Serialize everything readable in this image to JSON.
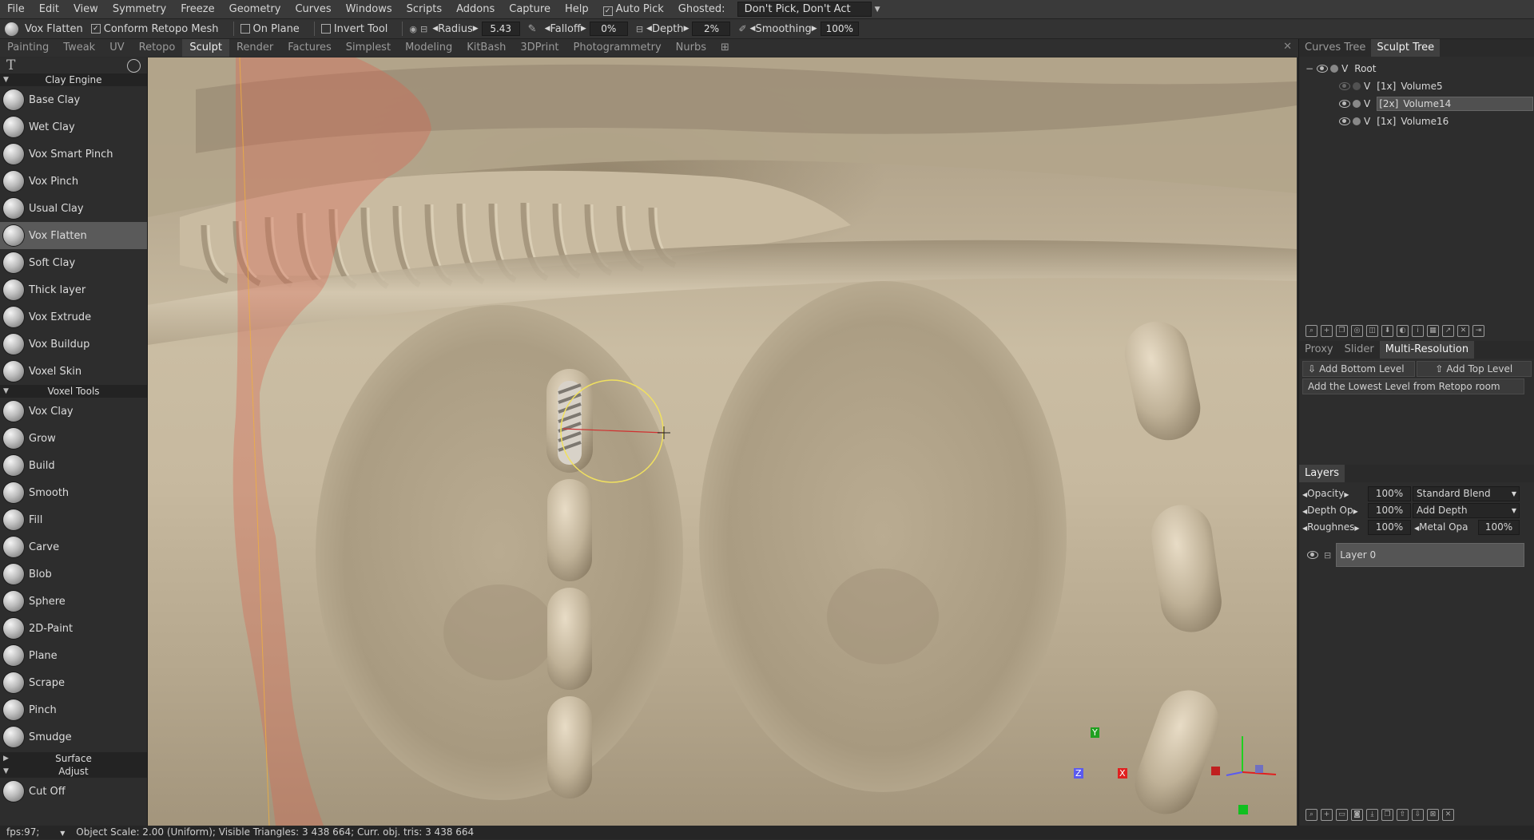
{
  "menubar": {
    "items": [
      "File",
      "Edit",
      "View",
      "Symmetry",
      "Freeze",
      "Geometry",
      "Curves",
      "Windows",
      "Scripts",
      "Addons",
      "Capture",
      "Help"
    ],
    "auto_pick": "Auto Pick",
    "ghosted_label": "Ghosted:",
    "ghosted_value": "Don't Pick, Don't Act"
  },
  "optbar": {
    "tool_name": "Vox Flatten",
    "conform_retopo": "Conform Retopo Mesh",
    "on_plane": "On Plane",
    "invert_tool": "Invert Tool",
    "radius_label": "Radius",
    "radius_value": "5.43",
    "falloff_label": "Falloff",
    "falloff_value": "0%",
    "depth_label": "Depth",
    "depth_value": "2%",
    "smoothing_label": "Smoothing",
    "smoothing_value": "100%"
  },
  "rooms": {
    "tabs": [
      "Painting",
      "Tweak",
      "UV",
      "Retopo",
      "Sculpt",
      "Render",
      "Factures",
      "Simplest",
      "Modeling",
      "KitBash",
      "3DPrint",
      "Photogrammetry",
      "Nurbs"
    ],
    "active": "Sculpt"
  },
  "leftpanel": {
    "clay_engine_title": "Clay Engine",
    "clay_tools": [
      "Base Clay",
      "Wet Clay",
      "Vox Smart Pinch",
      "Vox Pinch",
      "Usual Clay",
      "Vox Flatten",
      "Soft Clay",
      "Thick layer",
      "Vox Extrude",
      "Vox Buildup",
      "Voxel Skin"
    ],
    "voxel_tools_title": "Voxel Tools",
    "voxel_tools": [
      "Vox Clay",
      "Grow",
      "Build",
      "Smooth",
      "Fill",
      "Carve",
      "Blob",
      "Sphere",
      "2D-Paint",
      "Plane",
      "Scrape",
      "Pinch",
      "Smudge"
    ],
    "surface_title": "Surface",
    "adjust_title": "Adjust",
    "adjust_tools": [
      "Cut Off"
    ],
    "active_tool": "Vox Flatten"
  },
  "rightpanel": {
    "tree_tabs": [
      "Curves Tree",
      "Sculpt Tree"
    ],
    "active_tree_tab": "Sculpt Tree",
    "root_label": "Root",
    "volumes": [
      {
        "flag": "V",
        "mult": "[1x]",
        "name": "Volume5"
      },
      {
        "flag": "V",
        "mult": "[2x]",
        "name": "Volume14"
      },
      {
        "flag": "V",
        "mult": "[1x]",
        "name": "Volume16"
      }
    ],
    "root_flag": "V",
    "selected_volume": "Volume14",
    "res_tabs": [
      "Proxy",
      "Slider",
      "Multi-Resolution"
    ],
    "active_res_tab": "Multi-Resolution",
    "add_bottom_level": "Add Bottom Level",
    "add_top_level": "Add Top Level",
    "add_lowest_level": "Add the Lowest Level from Retopo room",
    "layers_tab": "Layers",
    "opacity_label": "Opacity",
    "opacity_value": "100%",
    "blend_mode": "Standard Blend",
    "depth_op_label": "Depth Op",
    "depth_op_value": "100%",
    "depth_mode": "Add Depth",
    "roughness_label": "Roughnes",
    "roughness_value": "100%",
    "metal_label": "Metal Opa",
    "metal_value": "100%",
    "layer_name": "Layer 0"
  },
  "gizmo": {
    "y": "Y",
    "z": "Z",
    "x": "X"
  },
  "statusbar": {
    "fps": "fps:97;",
    "info": "Object Scale: 2.00 (Uniform); Visible Triangles: 3 438 664; Curr. obj. tris: 3 438 664"
  },
  "colors": {
    "accent_highlight": "#5a5a5a",
    "gizmo_x": "#e02020",
    "gizmo_y": "#20d020",
    "gizmo_z": "#5a5af0",
    "brush_circle": "#f0e060",
    "freeze_overlay": "#d9624e"
  }
}
